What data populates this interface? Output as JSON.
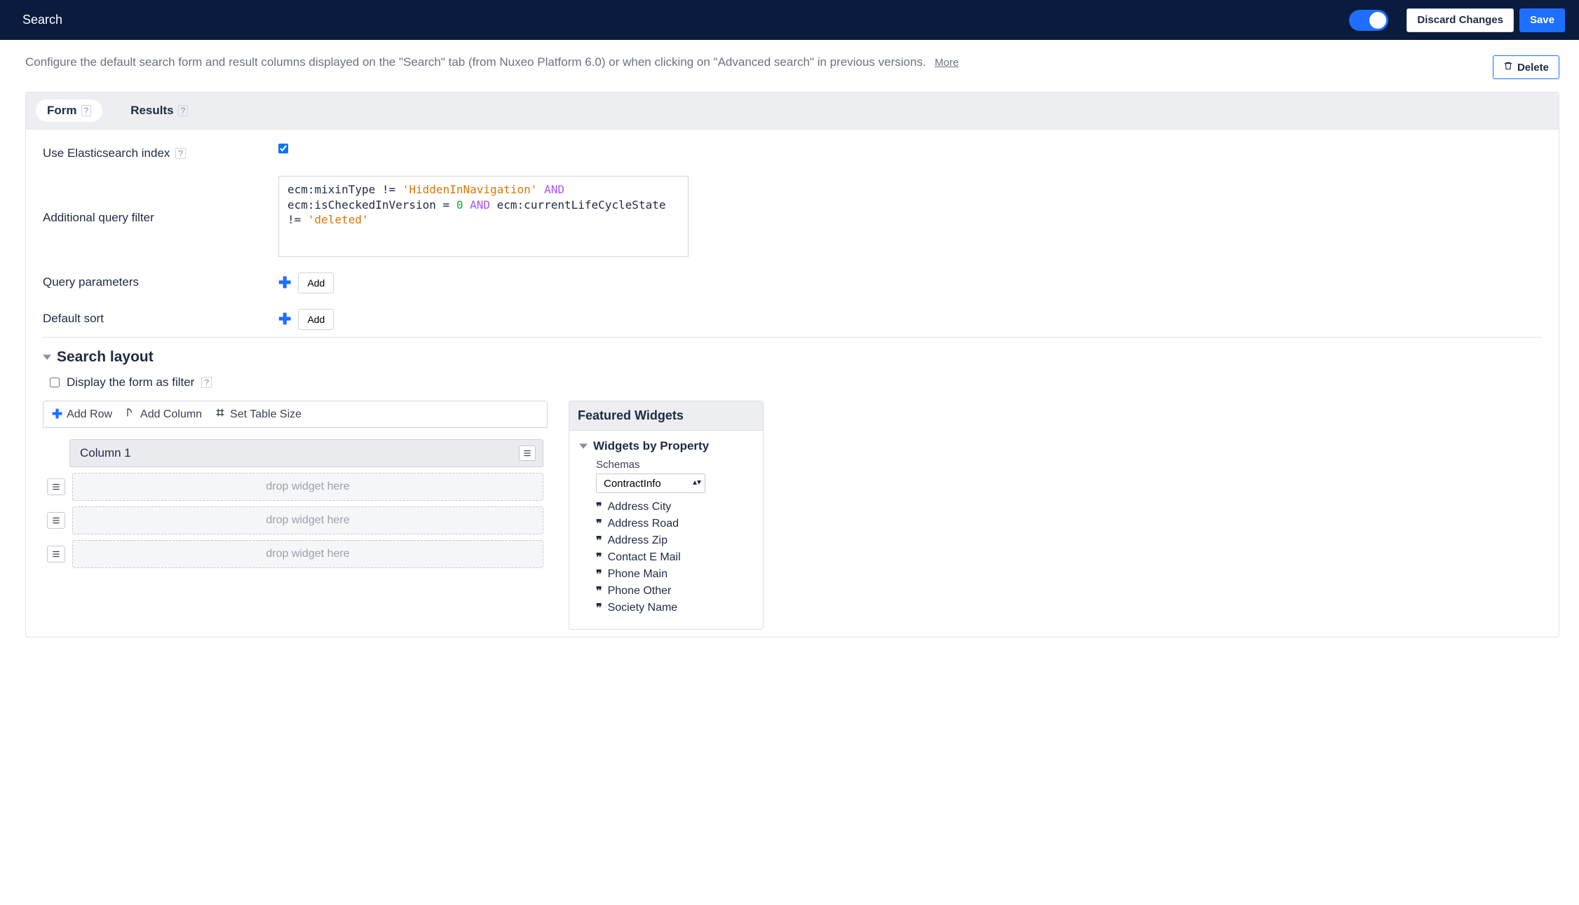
{
  "topbar": {
    "title": "Search",
    "discard": "Discard Changes",
    "save": "Save"
  },
  "intro": {
    "text": "Configure the default search form and result columns displayed on the \"Search\" tab (from Nuxeo Platform 6.0) or when clicking on \"Advanced search\" in previous versions.",
    "more": "More",
    "delete": "Delete"
  },
  "tabs": {
    "form": "Form",
    "results": "Results"
  },
  "fields": {
    "use_es": "Use Elasticsearch index",
    "query_filter": "Additional query filter",
    "query_params": "Query parameters",
    "default_sort": "Default sort",
    "add": "Add"
  },
  "query_tokens": [
    {
      "t": "plain",
      "v": "ecm:mixinType != "
    },
    {
      "t": "str",
      "v": "'HiddenInNavigation'"
    },
    {
      "t": "plain",
      "v": " "
    },
    {
      "t": "kw",
      "v": "AND"
    },
    {
      "t": "plain",
      "v": " ecm:isCheckedInVersion = "
    },
    {
      "t": "num",
      "v": "0"
    },
    {
      "t": "plain",
      "v": " "
    },
    {
      "t": "kw",
      "v": "AND"
    },
    {
      "t": "plain",
      "v": " ecm:currentLifeCycleState != "
    },
    {
      "t": "str",
      "v": "'deleted'"
    }
  ],
  "layout": {
    "section": "Search layout",
    "filter_label": "Display the form as filter",
    "add_row": "Add Row",
    "add_column": "Add Column",
    "set_table_size": "Set Table Size",
    "column_label": "Column 1",
    "drop_hint": "drop widget here"
  },
  "widgets": {
    "panel_title": "Featured Widgets",
    "by_property": "Widgets by Property",
    "schemas_label": "Schemas",
    "schema_selected": "ContractInfo",
    "items": [
      "Address City",
      "Address Road",
      "Address Zip",
      "Contact E Mail",
      "Phone Main",
      "Phone Other",
      "Society Name"
    ]
  }
}
